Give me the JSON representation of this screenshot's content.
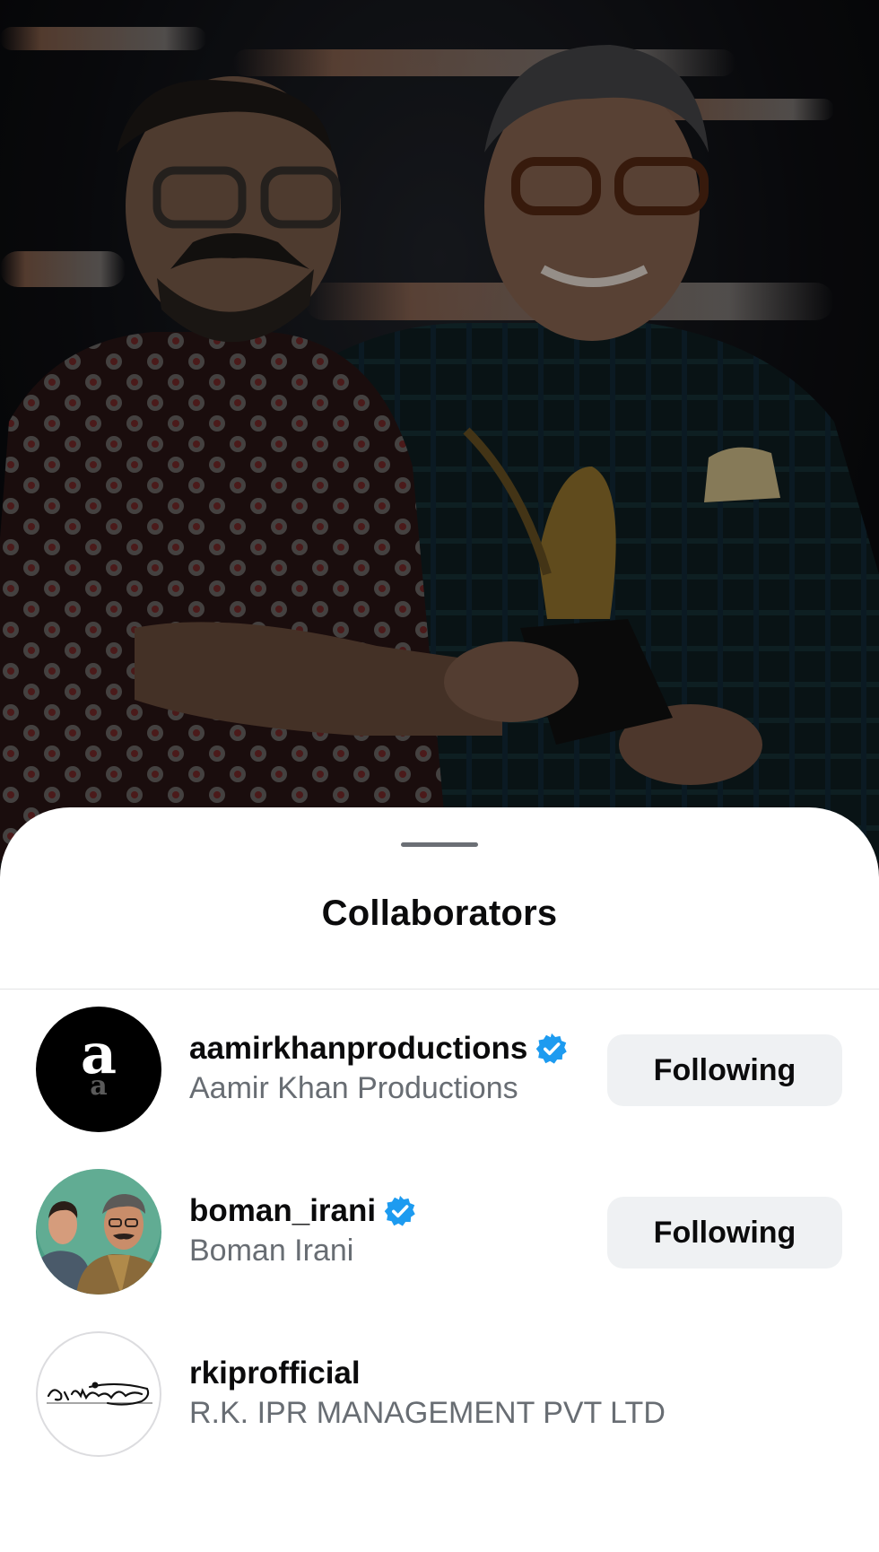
{
  "sheet": {
    "title": "Collaborators"
  },
  "collaborators": [
    {
      "username": "aamirkhanproductions",
      "full_name": "Aamir Khan Productions",
      "verified": true,
      "button_label": "Following",
      "avatar": "aamir-khan-productions-logo"
    },
    {
      "username": "boman_irani",
      "full_name": "Boman Irani",
      "verified": true,
      "button_label": "Following",
      "avatar": "boman-irani-illustration"
    },
    {
      "username": "rkiprofficial",
      "full_name": "R.K. IPR MANAGEMENT PVT LTD",
      "verified": false,
      "avatar": "rk-signature-logo"
    }
  ],
  "colors": {
    "verified_badge": "#1d9bf0",
    "button_bg": "#eff1f3",
    "secondary_text": "#686d73"
  }
}
